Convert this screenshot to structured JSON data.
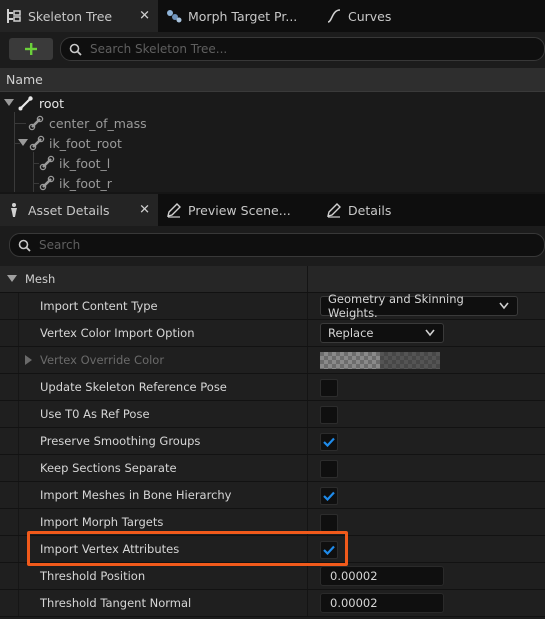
{
  "tabs_top": [
    {
      "label": "Skeleton Tree",
      "close": "✕"
    },
    {
      "label": "Morph Target Pr..."
    },
    {
      "label": "Curves"
    }
  ],
  "skeleton_search": {
    "placeholder": "Search Skeleton Tree..."
  },
  "tree": {
    "column_header": "Name",
    "bones": [
      {
        "name": "root"
      },
      {
        "name": "center_of_mass"
      },
      {
        "name": "ik_foot_root"
      },
      {
        "name": "ik_foot_l"
      },
      {
        "name": "ik_foot_r"
      }
    ]
  },
  "tabs_bottom": [
    {
      "label": "Asset Details",
      "close": "✕"
    },
    {
      "label": "Preview Scene..."
    },
    {
      "label": "Details"
    }
  ],
  "details_search": {
    "placeholder": "Search"
  },
  "section": {
    "title": "Mesh"
  },
  "properties": [
    {
      "name": "Import Content Type",
      "type": "combo",
      "value": "Geometry and Skinning Weights."
    },
    {
      "name": "Vertex Color Import Option",
      "type": "combo",
      "value": "Replace"
    },
    {
      "name": "Vertex Override Color",
      "type": "color",
      "enabled": false
    },
    {
      "name": "Update Skeleton Reference Pose",
      "type": "checkbox",
      "checked": false
    },
    {
      "name": "Use T0 As Ref Pose",
      "type": "checkbox",
      "checked": false
    },
    {
      "name": "Preserve Smoothing Groups",
      "type": "checkbox",
      "checked": true
    },
    {
      "name": "Keep Sections Separate",
      "type": "checkbox",
      "checked": false
    },
    {
      "name": "Import Meshes in Bone Hierarchy",
      "type": "checkbox",
      "checked": true
    },
    {
      "name": "Import Morph Targets",
      "type": "checkbox",
      "checked": false
    },
    {
      "name": "Import Vertex Attributes",
      "type": "checkbox",
      "checked": true,
      "highlighted": true
    },
    {
      "name": "Threshold Position",
      "type": "number",
      "value": "0.00002"
    },
    {
      "name": "Threshold Tangent Normal",
      "type": "number",
      "value": "0.00002"
    }
  ],
  "colors": {
    "accent": "#1f8bea",
    "add_green": "#6bd13a",
    "highlight": "#f15a1b"
  }
}
